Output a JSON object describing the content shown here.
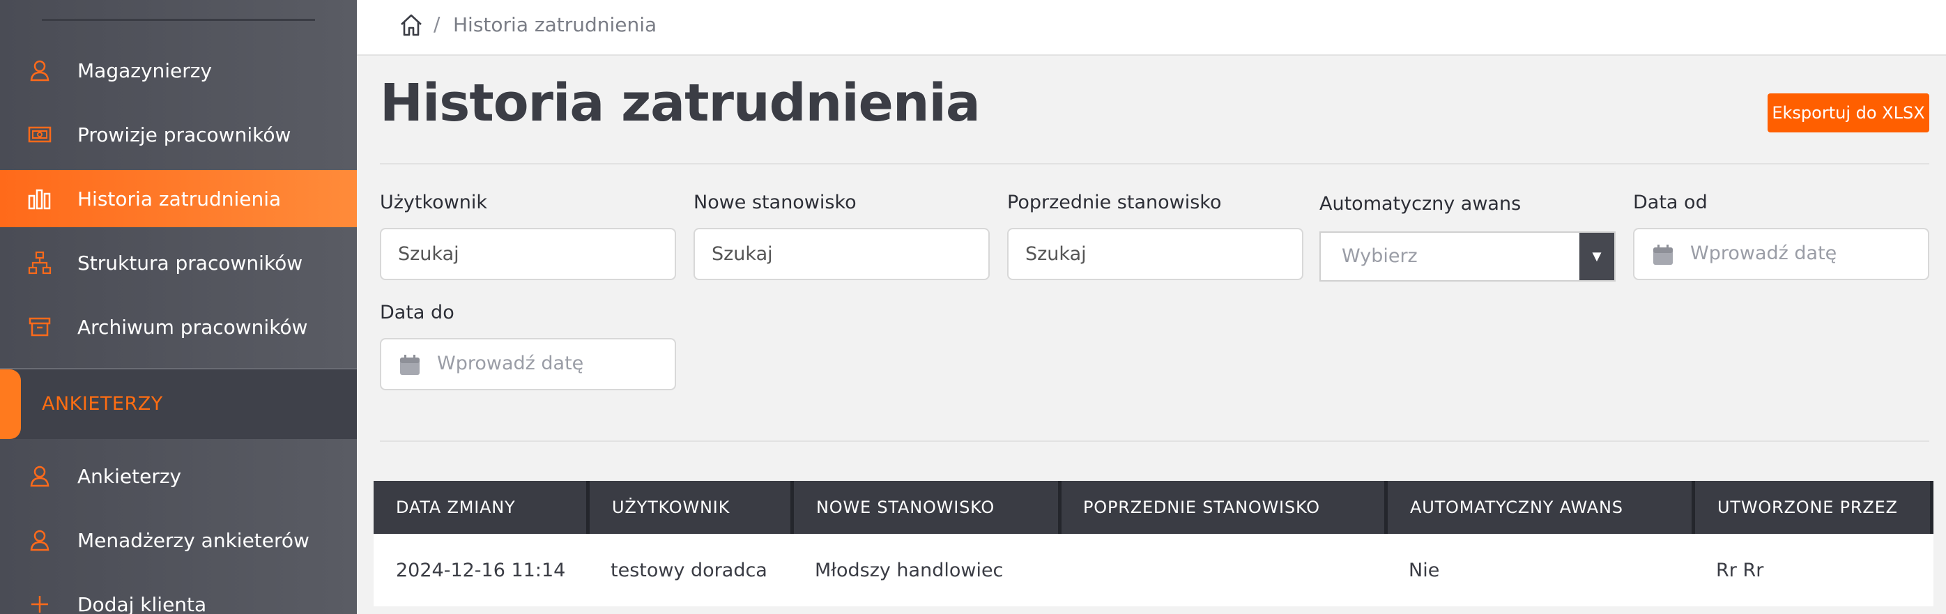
{
  "sidebar": {
    "items": [
      {
        "label": "Magazynierzy",
        "icon": "user-icon"
      },
      {
        "label": "Prowizje pracowników",
        "icon": "money-icon"
      },
      {
        "label": "Historia zatrudnienia",
        "icon": "bar-chart-icon",
        "active": true
      },
      {
        "label": "Struktura pracowników",
        "icon": "org-chart-icon"
      },
      {
        "label": "Archiwum pracowników",
        "icon": "archive-icon"
      }
    ],
    "section_header": "ANKIETERZY",
    "section_items": [
      {
        "label": "Ankieterzy",
        "icon": "user-icon"
      },
      {
        "label": "Menadżerzy ankieterów",
        "icon": "user-icon"
      },
      {
        "label": "Dodaj klienta",
        "icon": "plus-icon"
      }
    ],
    "accent_color": "#ff6a1a"
  },
  "topbar": {
    "separator": "/",
    "breadcrumb": "Historia zatrudnienia"
  },
  "main": {
    "title": "Historia zatrudnienia",
    "export_label": "Eksportuj do XLSX"
  },
  "filters": {
    "user": {
      "label": "Użytkownik",
      "placeholder": "Szukaj"
    },
    "new_position": {
      "label": "Nowe stanowisko",
      "placeholder": "Szukaj"
    },
    "prev_position": {
      "label": "Poprzednie stanowisko",
      "placeholder": "Szukaj"
    },
    "auto_promo": {
      "label": "Automatyczny awans",
      "value": "Wybierz"
    },
    "date_from": {
      "label": "Data od",
      "placeholder": "Wprowadź datę"
    },
    "date_to": {
      "label": "Data do",
      "placeholder": "Wprowadź datę"
    }
  },
  "table": {
    "columns": [
      "DATA ZMIANY",
      "UŻYTKOWNIK",
      "NOWE STANOWISKO",
      "POPRZEDNIE STANOWISKO",
      "AUTOMATYCZNY AWANS",
      "UTWORZONE PRZEZ"
    ],
    "rows": [
      [
        "2024-12-16 11:14",
        "testowy doradca",
        "Młodszy handlowiec",
        "",
        "Nie",
        "Rr Rr"
      ]
    ]
  }
}
